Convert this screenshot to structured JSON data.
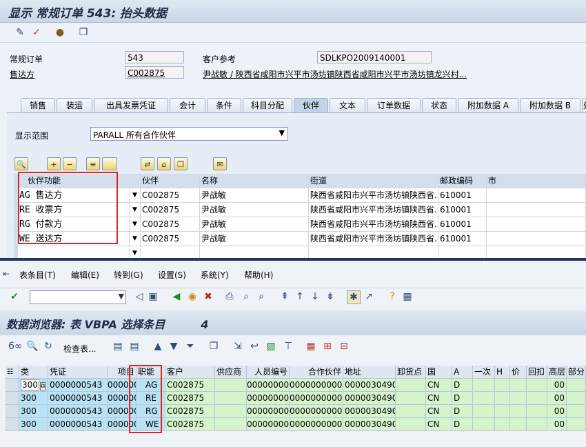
{
  "top": {
    "title": "显示 常规订单 543: 抬头数据",
    "order_label": "常规订单",
    "order_value": "543",
    "customer_ref_label": "客户参考",
    "customer_ref_value": "SDLKPO2009140001",
    "soldto_label": "售达方",
    "soldto_value": "C002875",
    "soldto_desc": "尹战敏 / 陕西省咸阳市兴平市汤坊镇陕西省咸阳市兴平市汤坊镇龙兴村...",
    "tabs": [
      "销售",
      "装运",
      "出具发票凭证",
      "会计",
      "条件",
      "科目分配",
      "伙伴",
      "文本",
      "订单数据",
      "状态",
      "附加数据 A",
      "附加数据 B",
      "处"
    ],
    "active_tab_index": 6,
    "display_range_label": "显示范围",
    "display_range_value": "PARALL 所有合作伙伴",
    "partner_columns": [
      "伙伴功能",
      "伙伴",
      "名称",
      "街道",
      "邮政编码",
      "市"
    ],
    "partner_rows": [
      {
        "function": "AG  售达方",
        "partner": "C002875",
        "name": "尹战敏",
        "street": "陕西省咸阳市兴平市汤坊镇陕西省...",
        "postal": "610001",
        "city": ""
      },
      {
        "function": "RE  收票方",
        "partner": "C002875",
        "name": "尹战敏",
        "street": "陕西省咸阳市兴平市汤坊镇陕西省...",
        "postal": "610001",
        "city": ""
      },
      {
        "function": "RG  付款方",
        "partner": "C002875",
        "name": "尹战敏",
        "street": "陕西省咸阳市兴平市汤坊镇陕西省...",
        "postal": "610001",
        "city": ""
      },
      {
        "function": "WE  送达方",
        "partner": "C002875",
        "name": "尹战敏",
        "street": "陕西省咸阳市兴平市汤坊镇陕西省...",
        "postal": "610001",
        "city": ""
      }
    ]
  },
  "bottom": {
    "menu": [
      "表条目(T)",
      "编辑(E)",
      "转到(G)",
      "设置(S)",
      "系统(Y)",
      "帮助(H)"
    ],
    "command_value": "",
    "title": "数据浏览器: 表 VBPA 选择条目",
    "count": "4",
    "check_table_label": "检查表...",
    "grid_columns": [
      "类",
      "凭证",
      "项目",
      "职能",
      "客户",
      "供应商",
      "人员编号",
      "合作伙伴",
      "地址",
      "卸货点",
      "国",
      "A",
      "一次",
      "H",
      "价",
      "回扣",
      "高层",
      "部分"
    ],
    "grid_rows": [
      [
        "300",
        "0000000543",
        "000000",
        "AG",
        "C002875",
        "",
        "00000000",
        "0000000000",
        "0000030490",
        "",
        "CN",
        "D",
        "",
        "",
        "",
        "",
        "00",
        ""
      ],
      [
        "300",
        "0000000543",
        "000000",
        "RE",
        "C002875",
        "",
        "00000000",
        "0000000000",
        "0000030490",
        "",
        "CN",
        "D",
        "",
        "",
        "",
        "",
        "00",
        ""
      ],
      [
        "300",
        "0000000543",
        "000000",
        "RG",
        "C002875",
        "",
        "00000000",
        "0000000000",
        "0000030490",
        "",
        "CN",
        "D",
        "",
        "",
        "",
        "",
        "00",
        ""
      ],
      [
        "300",
        "0000000543",
        "000000",
        "WE",
        "C002875",
        "",
        "00000000",
        "0000000000",
        "0000030490",
        "",
        "CN",
        "D",
        "",
        "",
        "",
        "",
        "00",
        ""
      ]
    ]
  },
  "colors": {
    "key_cell": "#b9e3f4",
    "nonkey_cell": "#d6f4cc",
    "highlight_box": "#e02424"
  }
}
